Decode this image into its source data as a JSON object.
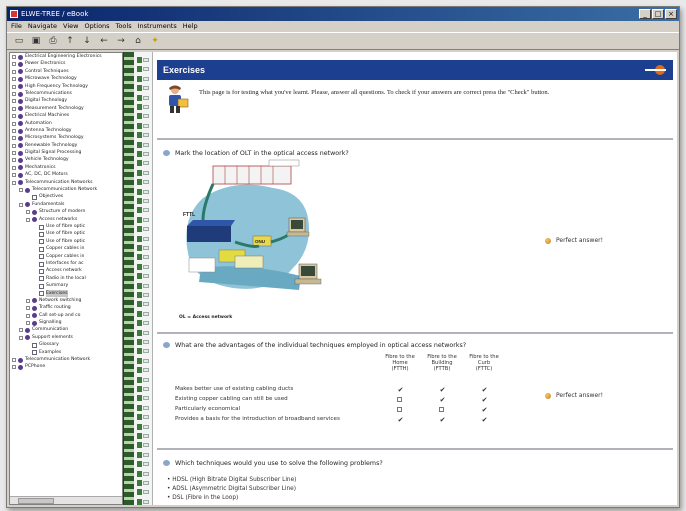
{
  "window": {
    "title": "ELWE-TREE / eBook"
  },
  "menu": [
    {
      "label": "File"
    },
    {
      "label": "Navigate"
    },
    {
      "label": "View"
    },
    {
      "label": "Options"
    },
    {
      "label": "Tools"
    },
    {
      "label": "Instruments"
    },
    {
      "label": "Help"
    }
  ],
  "tree": [
    {
      "depth": 0,
      "kind": "node",
      "label": "Electrical Engineering Electronics"
    },
    {
      "depth": 0,
      "kind": "node",
      "label": "Power Electronics"
    },
    {
      "depth": 0,
      "kind": "node",
      "label": "Control Techniques"
    },
    {
      "depth": 0,
      "kind": "node",
      "label": "Microwave Technology"
    },
    {
      "depth": 0,
      "kind": "node",
      "label": "High Frequency Technology"
    },
    {
      "depth": 0,
      "kind": "node",
      "label": "Telecommunications"
    },
    {
      "depth": 0,
      "kind": "node",
      "label": "Digital Technology"
    },
    {
      "depth": 0,
      "kind": "node",
      "label": "Measurement Technology"
    },
    {
      "depth": 0,
      "kind": "node",
      "label": "Electrical Machines"
    },
    {
      "depth": 0,
      "kind": "node",
      "label": "Automation"
    },
    {
      "depth": 0,
      "kind": "node",
      "label": "Antenna Technology"
    },
    {
      "depth": 0,
      "kind": "node",
      "label": "Microsystems Technology"
    },
    {
      "depth": 0,
      "kind": "node",
      "label": "Renewable Technology"
    },
    {
      "depth": 0,
      "kind": "node",
      "label": "Digital Signal Processing"
    },
    {
      "depth": 0,
      "kind": "node",
      "label": "Vehicle Technology"
    },
    {
      "depth": 0,
      "kind": "node",
      "label": "Mechatronics"
    },
    {
      "depth": 0,
      "kind": "node",
      "label": "AC, DC, DC Motors"
    },
    {
      "depth": 0,
      "kind": "node",
      "label": "Telecommunication Networks"
    },
    {
      "depth": 1,
      "kind": "node",
      "label": "Telecommunication Network"
    },
    {
      "depth": 2,
      "kind": "page",
      "label": "Objectives"
    },
    {
      "depth": 1,
      "kind": "node",
      "label": "Fundamentals"
    },
    {
      "depth": 2,
      "kind": "node",
      "label": "Structure of modern"
    },
    {
      "depth": 2,
      "kind": "node",
      "label": "Access networks"
    },
    {
      "depth": 3,
      "kind": "page",
      "label": "Use of fibre optic"
    },
    {
      "depth": 3,
      "kind": "page",
      "label": "Use of fibre optic"
    },
    {
      "depth": 3,
      "kind": "page",
      "label": "Use of fibre optic"
    },
    {
      "depth": 3,
      "kind": "page",
      "label": "Copper cables in"
    },
    {
      "depth": 3,
      "kind": "page",
      "label": "Copper cables in"
    },
    {
      "depth": 3,
      "kind": "page",
      "label": "Interfaces for ac"
    },
    {
      "depth": 3,
      "kind": "page",
      "label": "Access network"
    },
    {
      "depth": 3,
      "kind": "page",
      "label": "Radio in the local"
    },
    {
      "depth": 3,
      "kind": "page",
      "label": "Summary"
    },
    {
      "depth": 3,
      "kind": "page",
      "label": "Exercises",
      "selected": true
    },
    {
      "depth": 2,
      "kind": "node",
      "label": "Network switching"
    },
    {
      "depth": 2,
      "kind": "node",
      "label": "Traffic routing"
    },
    {
      "depth": 2,
      "kind": "node",
      "label": "Call set-up and co"
    },
    {
      "depth": 2,
      "kind": "node",
      "label": "Signalling"
    },
    {
      "depth": 1,
      "kind": "node",
      "label": "Communication"
    },
    {
      "depth": 1,
      "kind": "node",
      "label": "Support elements"
    },
    {
      "depth": 2,
      "kind": "page",
      "label": "Glossary"
    },
    {
      "depth": 2,
      "kind": "page",
      "label": "Examples"
    },
    {
      "depth": 0,
      "kind": "node",
      "label": "Telecommunication Network"
    },
    {
      "depth": 0,
      "kind": "node",
      "label": "PCPhone"
    }
  ],
  "page": {
    "title": "Exercises",
    "intro": "This page is for testing what you've learnt. Please, answer all questions. To check if your answers are correct press the \"Check\" button.",
    "q1": {
      "text": "Mark the location of OLT in the optical access network?",
      "answer": "Perfect answer!",
      "diagram": {
        "fttl": "FTTL",
        "onu": "ONU",
        "caption": "OL = Access network"
      }
    },
    "q2": {
      "text": "What are the advantages of the individual techniques employed in optical access networks?",
      "answer": "Perfect answer!",
      "columns": [
        "Fibre to the Home (FTTH)",
        "Fibre to the Building (FTTB)",
        "Fibre to the Curb (FTTC)"
      ],
      "rows": [
        {
          "label": "Makes better use of existing cabling ducts",
          "checks": [
            true,
            true,
            true
          ]
        },
        {
          "label": "Existing copper cabling can still be used",
          "checks": [
            false,
            true,
            true
          ]
        },
        {
          "label": "Particularly economical",
          "checks": [
            false,
            false,
            true
          ]
        },
        {
          "label": "Provides a basis for the introduction of broadband services",
          "checks": [
            true,
            true,
            true
          ]
        }
      ]
    },
    "q3": {
      "text": "Which techniques would you use to solve the following problems?",
      "bullets": [
        "HDSL (High Bitrate Digital Subscriber Line)",
        "ADSL (Asymmetric Digital Subscriber Line)",
        "DSL (Fibre in the Loop)"
      ]
    }
  }
}
